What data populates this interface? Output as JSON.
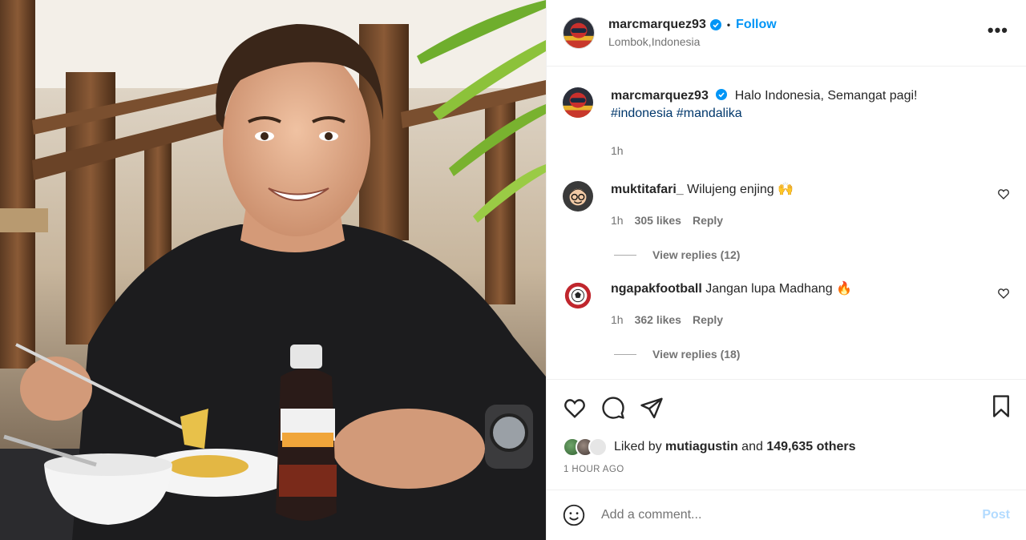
{
  "post": {
    "username": "marcmarquez93",
    "follow_label": "Follow",
    "separator": "•",
    "location": "Lombok,Indonesia",
    "more_label": "•••"
  },
  "caption": {
    "username": "marcmarquez93",
    "text": "Halo Indonesia, Semangat pagi!",
    "hashtags": [
      "#indonesia",
      "#mandalika"
    ],
    "time": "1h"
  },
  "comments": [
    {
      "username": "muktitafari_",
      "text": "Wilujeng enjing 🙌",
      "time": "1h",
      "likes": "305 likes",
      "reply_label": "Reply",
      "view_replies": "View replies (12)"
    },
    {
      "username": "ngapakfootball",
      "text": "Jangan lupa Madhang 🔥",
      "time": "1h",
      "likes": "362 likes",
      "reply_label": "Reply",
      "view_replies": "View replies (18)"
    }
  ],
  "likes": {
    "prefix": "Liked by",
    "user": "mutiagustin",
    "connector": "and",
    "others": "149,635 others"
  },
  "timestamp": "1 HOUR AGO",
  "composer": {
    "placeholder": "Add a comment...",
    "post_label": "Post"
  },
  "icons": {
    "like": "heart-icon",
    "comment": "comment-icon",
    "share": "share-icon",
    "save": "bookmark-icon",
    "emoji": "emoji-icon",
    "verified": "verified-badge-icon"
  },
  "colors": {
    "accent": "#0095f6",
    "hashtag": "#00376b",
    "muted": "#737373",
    "post_disabled": "#b3dbff"
  }
}
